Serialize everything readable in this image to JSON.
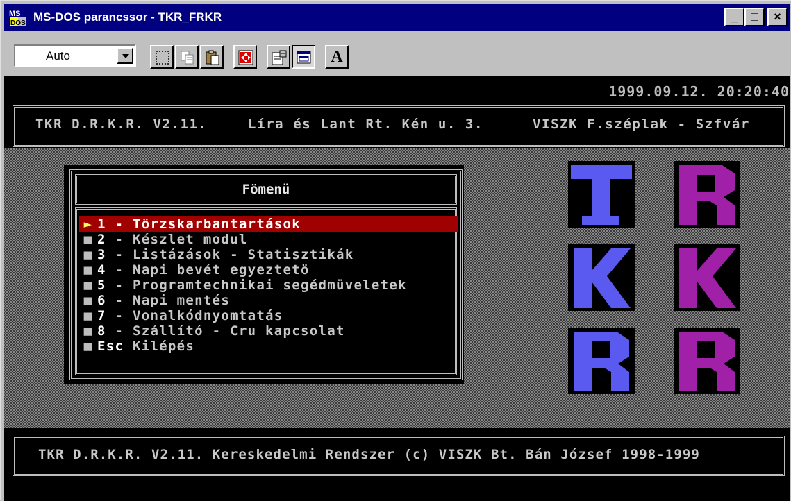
{
  "window": {
    "title": "MS-DOS parancssor - TKR_FRKR",
    "controls": {
      "minimize": "_",
      "maximize": "□",
      "close": "×"
    }
  },
  "toolbar": {
    "font_size_value": "Auto",
    "tools": [
      "mark-icon",
      "copy-icon",
      "paste-icon",
      "fullscreen-icon",
      "properties-icon",
      "background-icon",
      "font-icon"
    ],
    "font_button_label": "A"
  },
  "console": {
    "datetime": "1999.09.12. 20:20:40",
    "header": {
      "left": "TKR D.R.K.R. V2.11.",
      "middle": "Líra és Lant Rt. Kén u. 3.",
      "right": "VISZK F.széplak - Szfvár"
    },
    "menu": {
      "title": "Fömenü",
      "items": [
        {
          "key": "1",
          "label": "- Törzskarbantartások",
          "selected": true
        },
        {
          "key": "2",
          "label": "- Készlet modul"
        },
        {
          "key": "3",
          "label": "- Listázások - Statisztikák"
        },
        {
          "key": "4",
          "label": "- Napi bevét egyeztetö"
        },
        {
          "key": "5",
          "label": "- Programtechnikai segédmüveletek"
        },
        {
          "key": "6",
          "label": "- Napi mentés"
        },
        {
          "key": "7",
          "label": "- Vonalkódnyomtatás"
        },
        {
          "key": "8",
          "label": "- Szállító - Cru kapcsolat"
        },
        {
          "key": "Esc",
          "label": "Kilépés"
        }
      ]
    },
    "logo": {
      "letters": [
        "T",
        "R",
        "K",
        "K",
        "R",
        "R"
      ],
      "colors": {
        "blue": "#5a5af0",
        "purple": "#a020a8"
      }
    },
    "footer": "TKR D.R.K.R. V2.11. Kereskedelmi Rendszer (c) VISZK Bt. Bán József 1998-1999"
  }
}
